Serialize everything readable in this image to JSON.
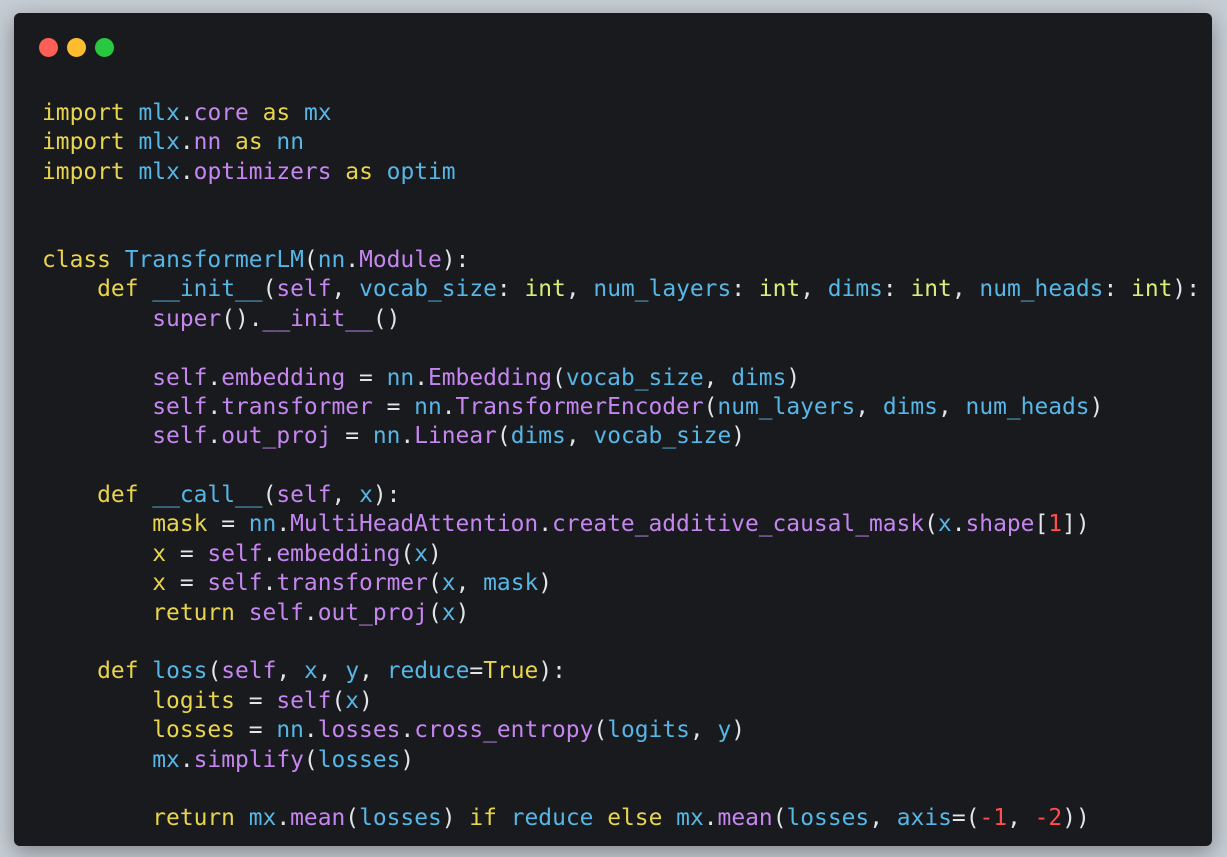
{
  "window": {
    "controls": [
      {
        "name": "close-button",
        "color": "#ff5f57"
      },
      {
        "name": "minimize-button",
        "color": "#febc2e"
      },
      {
        "name": "maximize-button",
        "color": "#28c840"
      }
    ]
  },
  "colors": {
    "kw": "#e8d44d",
    "attr": "#c586f0",
    "id": "#56b6e6",
    "text": "#e1e4e8",
    "type": "#d6ef7a",
    "num": "#ff4d4d"
  },
  "code": {
    "lines": [
      [
        [
          "kw",
          "import"
        ],
        [
          "text",
          " "
        ],
        [
          "id",
          "mlx"
        ],
        [
          "text",
          "."
        ],
        [
          "attr",
          "core"
        ],
        [
          "text",
          " "
        ],
        [
          "kw",
          "as"
        ],
        [
          "text",
          " "
        ],
        [
          "id",
          "mx"
        ]
      ],
      [
        [
          "kw",
          "import"
        ],
        [
          "text",
          " "
        ],
        [
          "id",
          "mlx"
        ],
        [
          "text",
          "."
        ],
        [
          "attr",
          "nn"
        ],
        [
          "text",
          " "
        ],
        [
          "kw",
          "as"
        ],
        [
          "text",
          " "
        ],
        [
          "id",
          "nn"
        ]
      ],
      [
        [
          "kw",
          "import"
        ],
        [
          "text",
          " "
        ],
        [
          "id",
          "mlx"
        ],
        [
          "text",
          "."
        ],
        [
          "attr",
          "optimizers"
        ],
        [
          "text",
          " "
        ],
        [
          "kw",
          "as"
        ],
        [
          "text",
          " "
        ],
        [
          "id",
          "optim"
        ]
      ],
      [],
      [],
      [
        [
          "kw",
          "class"
        ],
        [
          "text",
          " "
        ],
        [
          "id",
          "TransformerLM"
        ],
        [
          "text",
          "("
        ],
        [
          "id",
          "nn"
        ],
        [
          "text",
          "."
        ],
        [
          "attr",
          "Module"
        ],
        [
          "text",
          "):"
        ]
      ],
      [
        [
          "text",
          "    "
        ],
        [
          "kw",
          "def"
        ],
        [
          "text",
          " "
        ],
        [
          "id",
          "__init__"
        ],
        [
          "text",
          "("
        ],
        [
          "attr",
          "self"
        ],
        [
          "text",
          ", "
        ],
        [
          "id",
          "vocab_size"
        ],
        [
          "text",
          ": "
        ],
        [
          "type",
          "int"
        ],
        [
          "text",
          ", "
        ],
        [
          "id",
          "num_layers"
        ],
        [
          "text",
          ": "
        ],
        [
          "type",
          "int"
        ],
        [
          "text",
          ", "
        ],
        [
          "id",
          "dims"
        ],
        [
          "text",
          ": "
        ],
        [
          "type",
          "int"
        ],
        [
          "text",
          ", "
        ],
        [
          "id",
          "num_heads"
        ],
        [
          "text",
          ": "
        ],
        [
          "type",
          "int"
        ],
        [
          "text",
          "):"
        ]
      ],
      [
        [
          "text",
          "        "
        ],
        [
          "attr",
          "super"
        ],
        [
          "text",
          "()."
        ],
        [
          "attr",
          "__init__"
        ],
        [
          "text",
          "()"
        ]
      ],
      [],
      [
        [
          "text",
          "        "
        ],
        [
          "attr",
          "self"
        ],
        [
          "text",
          "."
        ],
        [
          "attr",
          "embedding"
        ],
        [
          "text",
          " = "
        ],
        [
          "id",
          "nn"
        ],
        [
          "text",
          "."
        ],
        [
          "attr",
          "Embedding"
        ],
        [
          "text",
          "("
        ],
        [
          "id",
          "vocab_size"
        ],
        [
          "text",
          ", "
        ],
        [
          "id",
          "dims"
        ],
        [
          "text",
          ")"
        ]
      ],
      [
        [
          "text",
          "        "
        ],
        [
          "attr",
          "self"
        ],
        [
          "text",
          "."
        ],
        [
          "attr",
          "transformer"
        ],
        [
          "text",
          " = "
        ],
        [
          "id",
          "nn"
        ],
        [
          "text",
          "."
        ],
        [
          "attr",
          "TransformerEncoder"
        ],
        [
          "text",
          "("
        ],
        [
          "id",
          "num_layers"
        ],
        [
          "text",
          ", "
        ],
        [
          "id",
          "dims"
        ],
        [
          "text",
          ", "
        ],
        [
          "id",
          "num_heads"
        ],
        [
          "text",
          ")"
        ]
      ],
      [
        [
          "text",
          "        "
        ],
        [
          "attr",
          "self"
        ],
        [
          "text",
          "."
        ],
        [
          "attr",
          "out_proj"
        ],
        [
          "text",
          " = "
        ],
        [
          "id",
          "nn"
        ],
        [
          "text",
          "."
        ],
        [
          "attr",
          "Linear"
        ],
        [
          "text",
          "("
        ],
        [
          "id",
          "dims"
        ],
        [
          "text",
          ", "
        ],
        [
          "id",
          "vocab_size"
        ],
        [
          "text",
          ")"
        ]
      ],
      [],
      [
        [
          "text",
          "    "
        ],
        [
          "kw",
          "def"
        ],
        [
          "text",
          " "
        ],
        [
          "id",
          "__call__"
        ],
        [
          "text",
          "("
        ],
        [
          "attr",
          "self"
        ],
        [
          "text",
          ", "
        ],
        [
          "id",
          "x"
        ],
        [
          "text",
          "):"
        ]
      ],
      [
        [
          "text",
          "        "
        ],
        [
          "kw",
          "mask"
        ],
        [
          "text",
          " = "
        ],
        [
          "id",
          "nn"
        ],
        [
          "text",
          "."
        ],
        [
          "attr",
          "MultiHeadAttention"
        ],
        [
          "text",
          "."
        ],
        [
          "attr",
          "create_additive_causal_mask"
        ],
        [
          "text",
          "("
        ],
        [
          "id",
          "x"
        ],
        [
          "text",
          "."
        ],
        [
          "attr",
          "shape"
        ],
        [
          "text",
          "["
        ],
        [
          "num",
          "1"
        ],
        [
          "text",
          "])"
        ]
      ],
      [
        [
          "text",
          "        "
        ],
        [
          "kw",
          "x"
        ],
        [
          "text",
          " = "
        ],
        [
          "attr",
          "self"
        ],
        [
          "text",
          "."
        ],
        [
          "attr",
          "embedding"
        ],
        [
          "text",
          "("
        ],
        [
          "id",
          "x"
        ],
        [
          "text",
          ")"
        ]
      ],
      [
        [
          "text",
          "        "
        ],
        [
          "kw",
          "x"
        ],
        [
          "text",
          " = "
        ],
        [
          "attr",
          "self"
        ],
        [
          "text",
          "."
        ],
        [
          "attr",
          "transformer"
        ],
        [
          "text",
          "("
        ],
        [
          "id",
          "x"
        ],
        [
          "text",
          ", "
        ],
        [
          "id",
          "mask"
        ],
        [
          "text",
          ")"
        ]
      ],
      [
        [
          "text",
          "        "
        ],
        [
          "kw",
          "return"
        ],
        [
          "text",
          " "
        ],
        [
          "attr",
          "self"
        ],
        [
          "text",
          "."
        ],
        [
          "attr",
          "out_proj"
        ],
        [
          "text",
          "("
        ],
        [
          "id",
          "x"
        ],
        [
          "text",
          ")"
        ]
      ],
      [],
      [
        [
          "text",
          "    "
        ],
        [
          "kw",
          "def"
        ],
        [
          "text",
          " "
        ],
        [
          "id",
          "loss"
        ],
        [
          "text",
          "("
        ],
        [
          "attr",
          "self"
        ],
        [
          "text",
          ", "
        ],
        [
          "id",
          "x"
        ],
        [
          "text",
          ", "
        ],
        [
          "id",
          "y"
        ],
        [
          "text",
          ", "
        ],
        [
          "id",
          "reduce"
        ],
        [
          "text",
          "="
        ],
        [
          "kw",
          "True"
        ],
        [
          "text",
          "):"
        ]
      ],
      [
        [
          "text",
          "        "
        ],
        [
          "kw",
          "logits"
        ],
        [
          "text",
          " = "
        ],
        [
          "attr",
          "self"
        ],
        [
          "text",
          "("
        ],
        [
          "id",
          "x"
        ],
        [
          "text",
          ")"
        ]
      ],
      [
        [
          "text",
          "        "
        ],
        [
          "kw",
          "losses"
        ],
        [
          "text",
          " = "
        ],
        [
          "id",
          "nn"
        ],
        [
          "text",
          "."
        ],
        [
          "attr",
          "losses"
        ],
        [
          "text",
          "."
        ],
        [
          "attr",
          "cross_entropy"
        ],
        [
          "text",
          "("
        ],
        [
          "id",
          "logits"
        ],
        [
          "text",
          ", "
        ],
        [
          "id",
          "y"
        ],
        [
          "text",
          ")"
        ]
      ],
      [
        [
          "text",
          "        "
        ],
        [
          "id",
          "mx"
        ],
        [
          "text",
          "."
        ],
        [
          "attr",
          "simplify"
        ],
        [
          "text",
          "("
        ],
        [
          "id",
          "losses"
        ],
        [
          "text",
          ")"
        ]
      ],
      [],
      [
        [
          "text",
          "        "
        ],
        [
          "kw",
          "return"
        ],
        [
          "text",
          " "
        ],
        [
          "id",
          "mx"
        ],
        [
          "text",
          "."
        ],
        [
          "attr",
          "mean"
        ],
        [
          "text",
          "("
        ],
        [
          "id",
          "losses"
        ],
        [
          "text",
          ") "
        ],
        [
          "kw",
          "if"
        ],
        [
          "text",
          " "
        ],
        [
          "id",
          "reduce"
        ],
        [
          "text",
          " "
        ],
        [
          "kw",
          "else"
        ],
        [
          "text",
          " "
        ],
        [
          "id",
          "mx"
        ],
        [
          "text",
          "."
        ],
        [
          "attr",
          "mean"
        ],
        [
          "text",
          "("
        ],
        [
          "id",
          "losses"
        ],
        [
          "text",
          ", "
        ],
        [
          "id",
          "axis"
        ],
        [
          "text",
          "=("
        ],
        [
          "num",
          "-1"
        ],
        [
          "text",
          ", "
        ],
        [
          "num",
          "-2"
        ],
        [
          "text",
          "))"
        ]
      ]
    ]
  }
}
